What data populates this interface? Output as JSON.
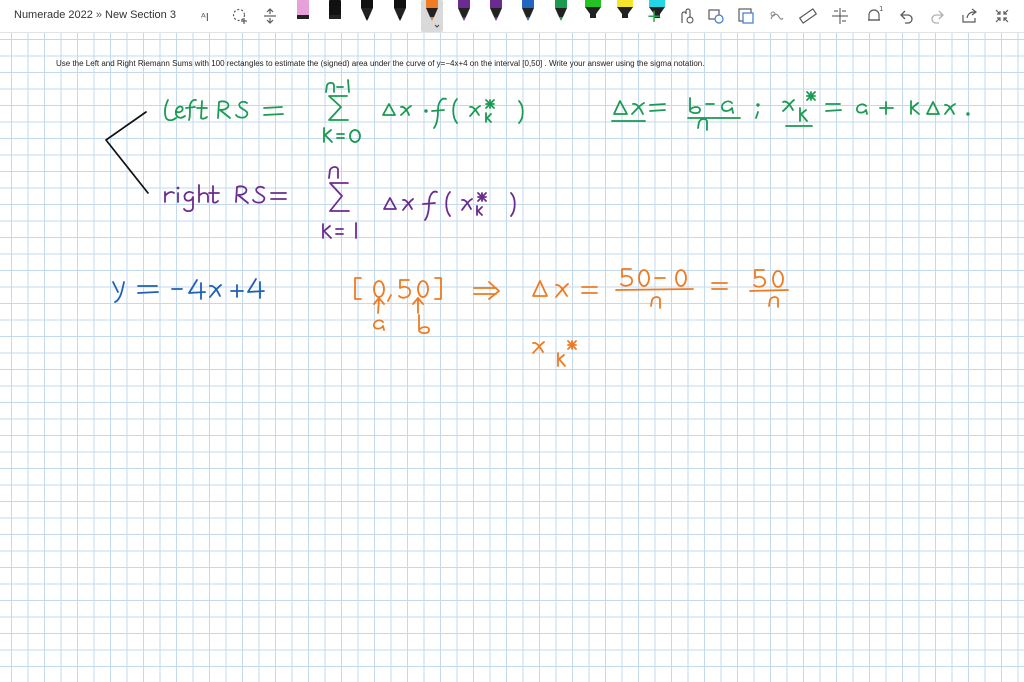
{
  "breadcrumb": {
    "notebook": "Numerade 2022",
    "separator": "»",
    "section": "New Section 3"
  },
  "toolbar": {
    "tools": [
      {
        "name": "type-text-icon"
      },
      {
        "name": "lasso-select-icon"
      },
      {
        "name": "add-space-icon"
      }
    ],
    "pens": [
      {
        "color": "#e7a1d9",
        "kind": "marker"
      },
      {
        "color": "#111111",
        "kind": "marker"
      },
      {
        "color": "#111111",
        "kind": "pen"
      },
      {
        "color": "#111111",
        "kind": "pen"
      },
      {
        "color": "#f07d24",
        "kind": "pen",
        "selected": true
      },
      {
        "color": "#6a2c91",
        "kind": "pen"
      },
      {
        "color": "#6a2c91",
        "kind": "pen"
      },
      {
        "color": "#2265c0",
        "kind": "pen"
      },
      {
        "color": "#1b9b4e",
        "kind": "pen"
      },
      {
        "color": "#22c322",
        "kind": "highlighter"
      },
      {
        "color": "#f5e52a",
        "kind": "highlighter"
      },
      {
        "color": "#22d6e6",
        "kind": "highlighter"
      }
    ],
    "right_tools": [
      {
        "name": "add-pen-icon",
        "glyph": "+"
      },
      {
        "name": "ink-to-shape-icon"
      },
      {
        "name": "ink-to-text-icon"
      },
      {
        "name": "ink-to-math-icon"
      },
      {
        "name": "replay-icon"
      },
      {
        "name": "ruler-icon"
      },
      {
        "name": "lasso-icon"
      },
      {
        "name": "notifications-icon"
      },
      {
        "name": "undo-icon"
      },
      {
        "name": "redo-icon"
      },
      {
        "name": "share-icon"
      },
      {
        "name": "fullscreen-icon"
      }
    ],
    "notification_count": "1"
  },
  "problem": {
    "text": "Use the Left and Right Riemann Sums with 100 rectangles to estimate the (signed) area under the curve of y=−4x+4 on the interval [0,50] . Write your answer using the sigma notation."
  },
  "ink_colors": {
    "green": "#1a9a52",
    "purple": "#6b2c8e",
    "blue": "#1e60b8",
    "orange": "#ee7b22",
    "grid": "#c3d9ee"
  }
}
